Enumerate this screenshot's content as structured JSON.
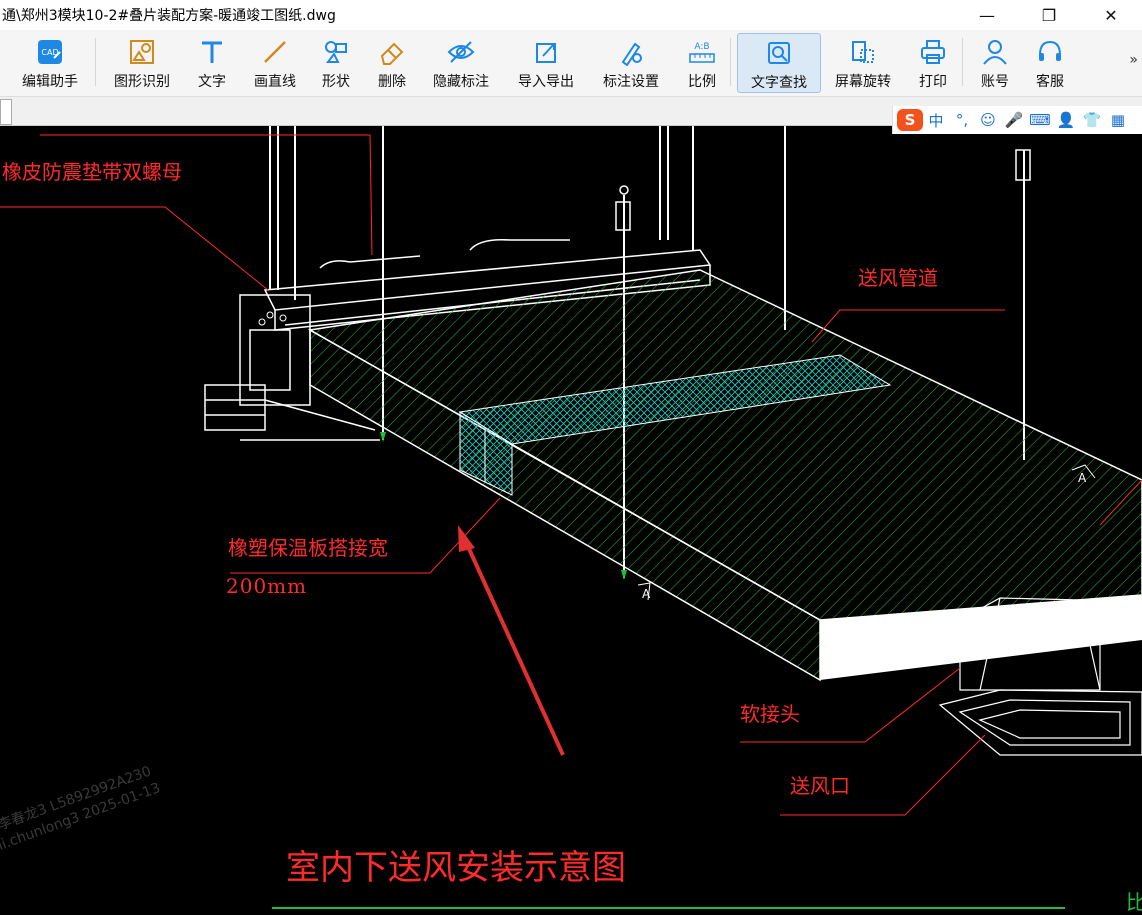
{
  "window": {
    "title": "通\\郑州3模块10-2#叠片装配方案-暖通竣工图纸.dwg",
    "minimize": "—",
    "maximize": "❐",
    "close": "✕"
  },
  "toolbar": {
    "items": [
      {
        "label": "编辑助手",
        "icon": "cad-helper-icon"
      },
      {
        "label": "图形识别",
        "icon": "shape-recognize-icon"
      },
      {
        "label": "文字",
        "icon": "text-icon"
      },
      {
        "label": "画直线",
        "icon": "line-icon"
      },
      {
        "label": "形状",
        "icon": "shape-icon"
      },
      {
        "label": "删除",
        "icon": "eraser-icon"
      },
      {
        "label": "隐藏标注",
        "icon": "eye-hide-icon"
      },
      {
        "label": "导入导出",
        "icon": "import-export-icon"
      },
      {
        "label": "标注设置",
        "icon": "annotation-settings-icon"
      },
      {
        "label": "比例",
        "icon": "scale-icon"
      },
      {
        "label": "文字查找",
        "icon": "text-search-icon",
        "active": true
      },
      {
        "label": "屏幕旋转",
        "icon": "rotate-icon"
      },
      {
        "label": "打印",
        "icon": "printer-icon"
      },
      {
        "label": "账号",
        "icon": "user-icon"
      },
      {
        "label": "客服",
        "icon": "headset-icon"
      }
    ],
    "more": "»",
    "cad_badge": "CAD"
  },
  "ime": {
    "lang": "中",
    "punct": "°,"
  },
  "drawing": {
    "label_rubber": "橡皮防震垫带双螺母",
    "label_duct": "送风管道",
    "label_insulation": "橡塑保温板搭接宽",
    "label_width": "200mm",
    "label_flex": "软接头",
    "label_outlet": "送风口",
    "title": "室内下送风安装示意图",
    "section_a1": "A",
    "section_a2": "A",
    "bottom_right": "比",
    "watermark_1": "李春龙3 L5892992A230",
    "watermark_2": "li.chunlong3 2025-01-13",
    "colors": {
      "hatch": "#1fbf3a",
      "label": "#ff2a2a",
      "linework": "#ffffff"
    }
  }
}
